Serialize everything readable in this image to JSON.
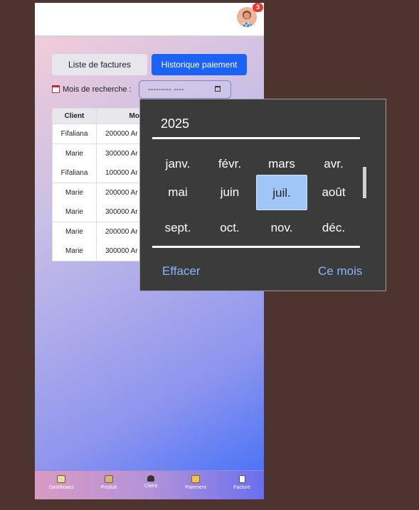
{
  "header": {
    "notification_count": "3"
  },
  "tabs": {
    "list_label": "Liste de factures",
    "history_label": "Historique paiement"
  },
  "search": {
    "month_label": "Mois de recherche :",
    "month_value": "--------- ----"
  },
  "table": {
    "headers": [
      "Client",
      "Montant"
    ],
    "rows": [
      {
        "client": "Fifaliana",
        "amount": "200000 Ar"
      },
      {
        "client": "Marie",
        "amount": "300000 Ar"
      },
      {
        "client": "Fifaliana",
        "amount": "100000 Ar"
      },
      {
        "client": "Marie",
        "amount": "200000 Ar"
      },
      {
        "client": "Marie",
        "amount": "300000 Ar"
      },
      {
        "client": "Marie",
        "amount": "200000 Ar"
      },
      {
        "client": "Marie",
        "amount": "300000 Ar"
      }
    ]
  },
  "picker": {
    "year": "2025",
    "months": [
      "janv.",
      "févr.",
      "mars",
      "avr.",
      "mai",
      "juin",
      "juil.",
      "août",
      "sept.",
      "oct.",
      "nov.",
      "déc."
    ],
    "selected_month": "juil.",
    "clear_label": "Effacer",
    "this_month_label": "Ce mois"
  },
  "nav": {
    "items": [
      {
        "label": "Dashboard",
        "icon": "chart-icon"
      },
      {
        "label": "Produit",
        "icon": "box-icon"
      },
      {
        "label": "Client",
        "icon": "users-icon"
      },
      {
        "label": "Paiement",
        "icon": "card-icon"
      },
      {
        "label": "Facture",
        "icon": "document-icon"
      }
    ]
  },
  "colors": {
    "accent": "#1c63f5",
    "badge": "#e53935",
    "selected_month": "#9fc6f7",
    "link": "#8ab4f8"
  }
}
